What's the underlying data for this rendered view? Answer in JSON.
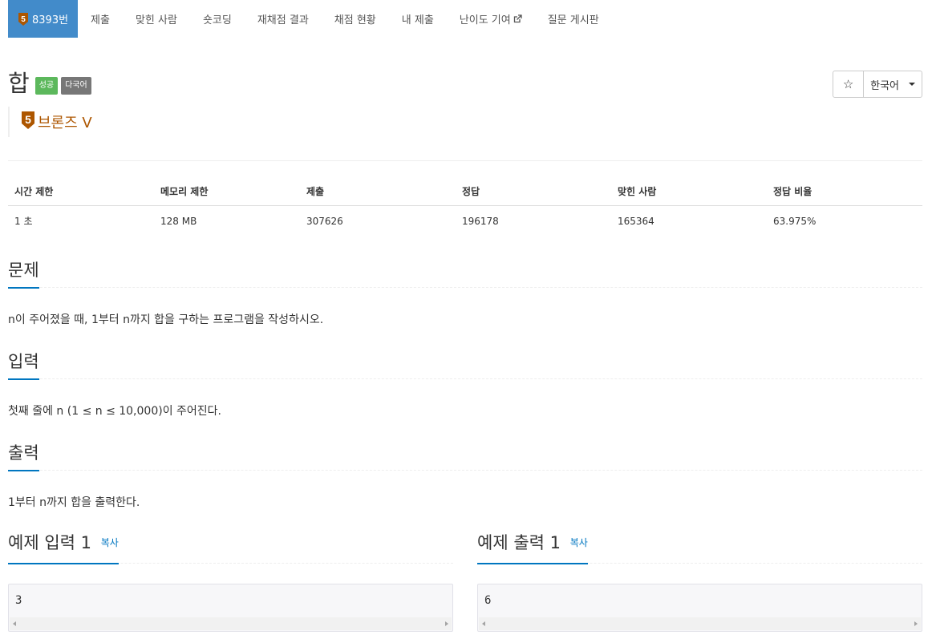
{
  "menu": {
    "problem_number": "8393번",
    "items": [
      "제출",
      "맞힌 사람",
      "숏코딩",
      "재채점 결과",
      "채점 현황",
      "내 제출",
      "난이도 기여",
      "질문 게시판"
    ],
    "tier_badge": "5"
  },
  "title": "합",
  "labels": {
    "success": "성공",
    "multilang": "다국어"
  },
  "tier": {
    "badge": "5",
    "name": "브론즈 V",
    "color": "#ad5600"
  },
  "toolbar": {
    "star": "☆",
    "language": "한국어"
  },
  "info": {
    "headers": [
      "시간 제한",
      "메모리 제한",
      "제출",
      "정답",
      "맞힌 사람",
      "정답 비율"
    ],
    "values": [
      "1 초",
      "128 MB",
      "307626",
      "196178",
      "165364",
      "63.975%"
    ]
  },
  "sections": {
    "problem": {
      "title": "문제",
      "text": "n이 주어졌을 때, 1부터 n까지 합을 구하는 프로그램을 작성하시오."
    },
    "input": {
      "title": "입력",
      "text": "첫째 줄에 n (1 ≤ n ≤ 10,000)이 주어진다."
    },
    "output": {
      "title": "출력",
      "text": "1부터 n까지 합을 출력한다."
    }
  },
  "samples": {
    "input": {
      "title": "예제 입력 1",
      "copy": "복사",
      "content": "3"
    },
    "output": {
      "title": "예제 출력 1",
      "copy": "복사",
      "content": "6"
    }
  },
  "colors": {
    "accent": "#428bca",
    "heading_underline": "#0076c0",
    "success": "#5cb85c",
    "bronze": "#ad5600"
  }
}
